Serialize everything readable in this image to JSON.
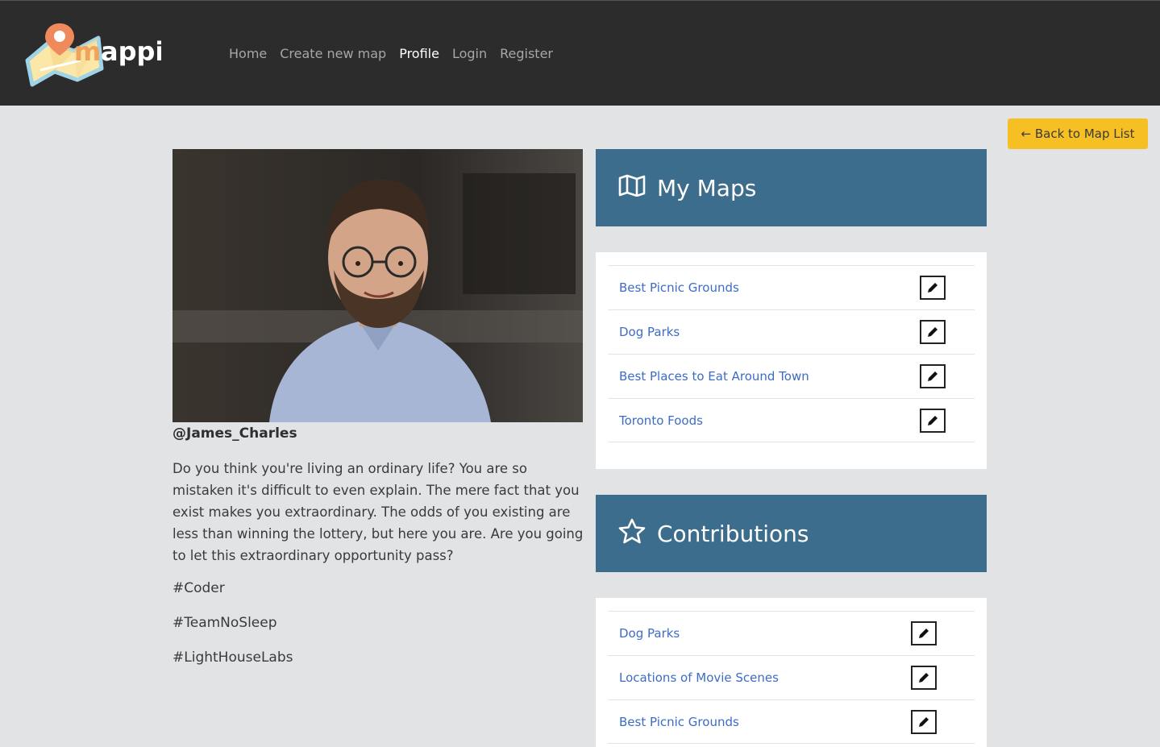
{
  "brand": {
    "name": "mappi",
    "accent": "#f2a25a"
  },
  "nav": {
    "items": [
      {
        "label": "Home",
        "active": false
      },
      {
        "label": "Create new map",
        "active": false
      },
      {
        "label": "Profile",
        "active": true
      },
      {
        "label": "Login",
        "active": false
      },
      {
        "label": "Register",
        "active": false
      }
    ]
  },
  "back_button": {
    "label": "← Back to Map List",
    "color": "#f6c024"
  },
  "profile": {
    "username": "@James_Charles",
    "bio": "Do you think you're living an ordinary life? You are so mistaken it's difficult to even explain. The mere fact that you exist makes you extraordinary. The odds of you existing are less than winning the lottery, but here you are. Are you going to let this extraordinary opportunity pass?",
    "tags": [
      "#Coder",
      "#TeamNoSleep",
      "#LightHouseLabs"
    ]
  },
  "my_maps": {
    "title": "My Maps",
    "icon": "map-icon",
    "items": [
      "Best Picnic Grounds",
      "Dog Parks",
      "Best Places to Eat Around Town",
      "Toronto Foods"
    ]
  },
  "contributions": {
    "title": "Contributions",
    "icon": "star-icon",
    "items": [
      "Dog Parks",
      "Locations of Movie Scenes",
      "Best Picnic Grounds"
    ]
  },
  "colors": {
    "header_bg": "#2c2c2c",
    "panel_head": "#3d6d8d",
    "link": "#3d6cc6",
    "page_bg": "#e2e3e5"
  }
}
